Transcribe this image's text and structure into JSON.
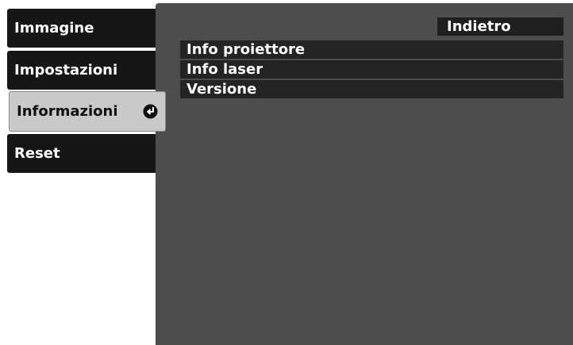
{
  "sidebar": {
    "items": [
      {
        "label": "Immagine"
      },
      {
        "label": "Impostazioni"
      },
      {
        "label": "Informazioni",
        "active": true,
        "icon": "enter-icon"
      },
      {
        "label": "Reset"
      }
    ]
  },
  "panel": {
    "back_label": "Indietro",
    "items": [
      {
        "label": "Info proiettore"
      },
      {
        "label": "Info laser"
      },
      {
        "label": "Versione"
      }
    ]
  },
  "colors": {
    "sidebar_item_bg": "#161616",
    "active_item_bg": "#c9c9c9",
    "panel_bg": "#4d4d4d",
    "menu_item_bg": "#242424"
  }
}
